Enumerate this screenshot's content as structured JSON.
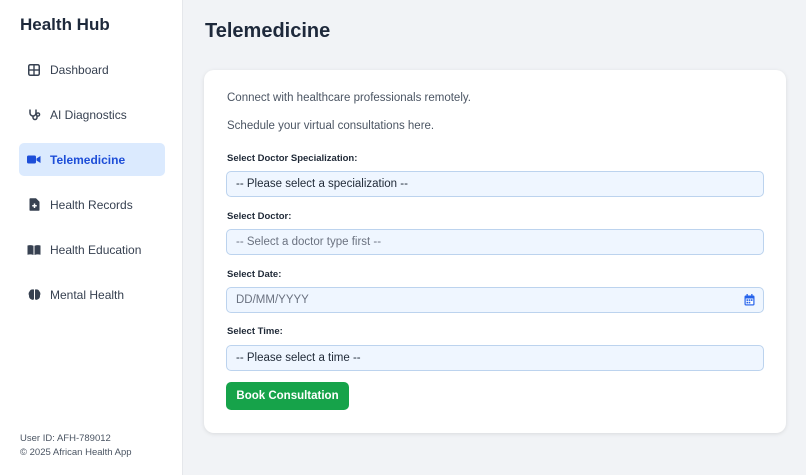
{
  "sidebar": {
    "brand": "Health Hub",
    "items": [
      {
        "label": "Dashboard",
        "icon": "dashboard-grid-icon",
        "active": false
      },
      {
        "label": "AI Diagnostics",
        "icon": "stethoscope-icon",
        "active": false
      },
      {
        "label": "Telemedicine",
        "icon": "video-camera-icon",
        "active": true
      },
      {
        "label": "Health Records",
        "icon": "medical-file-icon",
        "active": false
      },
      {
        "label": "Health Education",
        "icon": "book-open-icon",
        "active": false
      },
      {
        "label": "Mental Health",
        "icon": "brain-icon",
        "active": false
      }
    ],
    "footer": {
      "user_id": "User ID: AFH-789012",
      "copyright": "© 2025 African Health App"
    }
  },
  "main": {
    "title": "Telemedicine",
    "intro_line1": "Connect with healthcare professionals remotely.",
    "intro_line2": "Schedule your virtual consultations here.",
    "form": {
      "specialization_label": "Select Doctor Specialization:",
      "specialization_value": "-- Please select a specialization --",
      "doctor_label": "Select Doctor:",
      "doctor_value": "-- Select a doctor type first --",
      "date_label": "Select Date:",
      "date_placeholder": "DD/MM/YYYY",
      "time_label": "Select Time:",
      "time_value": "-- Please select a time --",
      "submit_label": "Book Consultation"
    }
  },
  "colors": {
    "accent": "#1d4ed8",
    "active_bg": "#dbeafe",
    "submit": "#16a34a",
    "field_bg": "#eff6ff"
  }
}
